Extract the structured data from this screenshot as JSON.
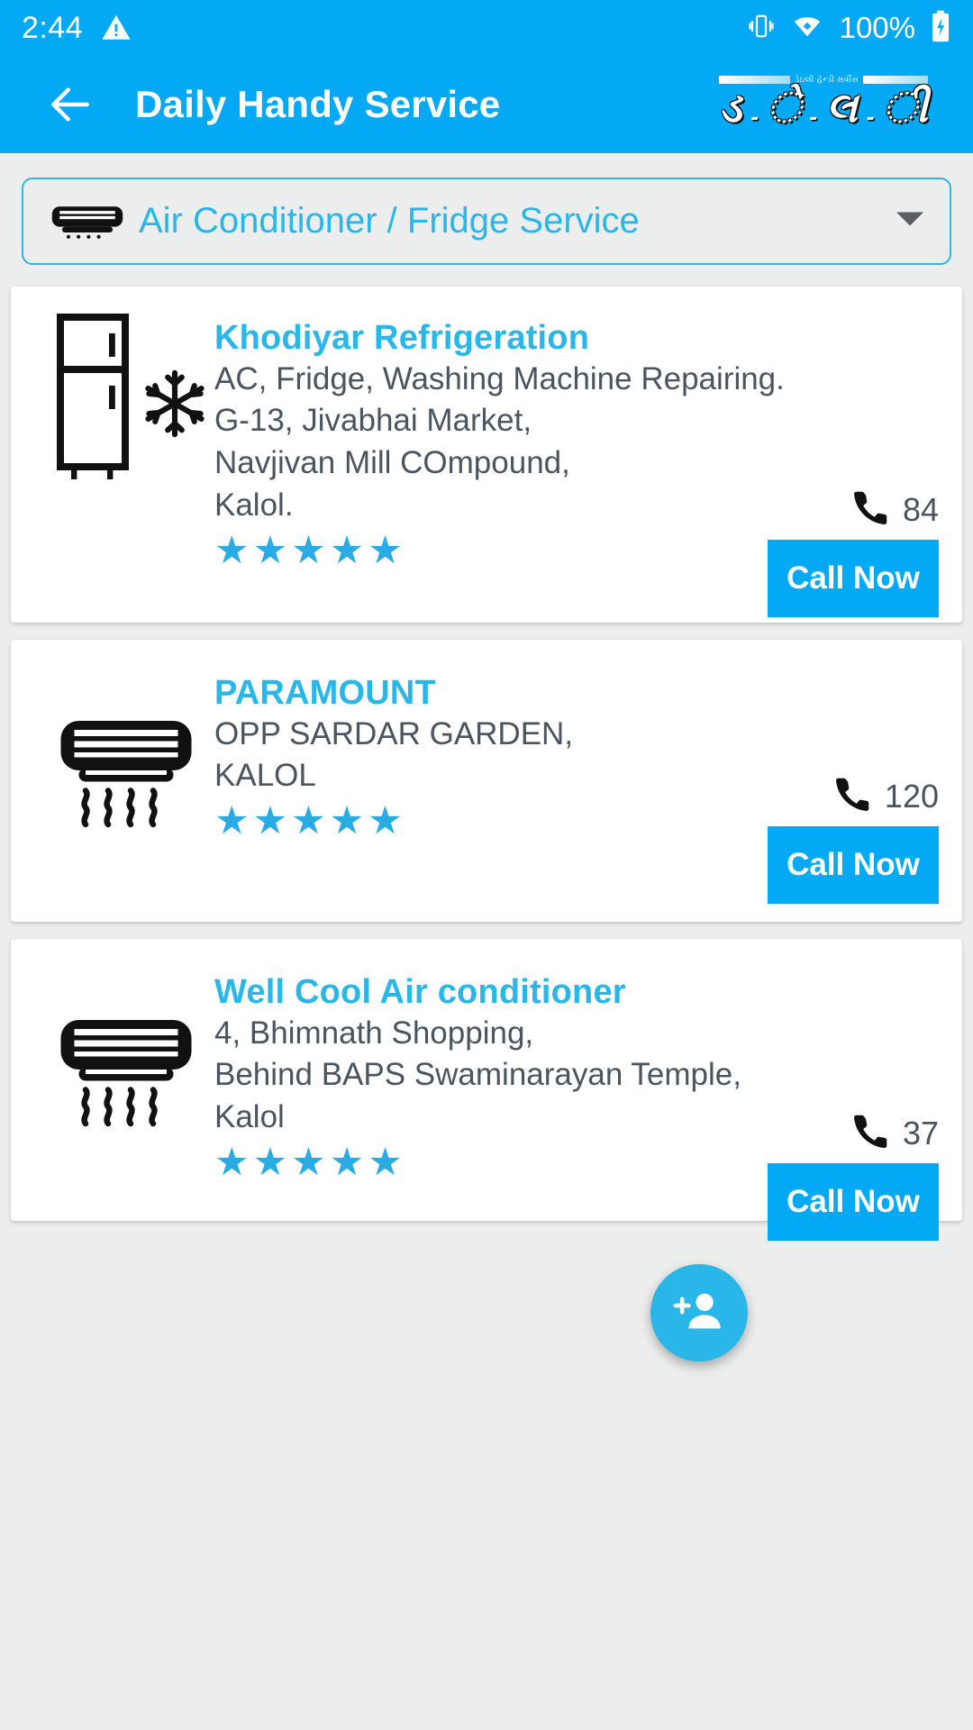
{
  "status_bar": {
    "time": "2:44",
    "warning_icon": "warning-triangle-icon",
    "vibrate_icon": "vibrate-icon",
    "wifi_icon": "wifi-icon",
    "battery_percent": "100%",
    "battery_icon": "battery-charging-icon"
  },
  "app_bar": {
    "back_icon": "back-arrow-icon",
    "title": "Daily Handy Service",
    "logo": {
      "tagline": "ડેઇલી હેન્ડી સર્વીસ",
      "glyphs": [
        "ડ",
        "ે",
        "લ",
        "ી"
      ],
      "separator": "-"
    }
  },
  "category_dropdown": {
    "icon": "air-conditioner-icon",
    "selected": "Air Conditioner / Fridge Service",
    "caret_icon": "chevron-down-icon"
  },
  "listings": [
    {
      "icon": "refrigerator-snowflake-icon",
      "name": "Khodiyar Refrigeration",
      "address_lines": [
        "AC, Fridge, Washing Machine Repairing.",
        "G-13, Jivabhai Market,",
        "Navjivan Mill COmpound,",
        "Kalol."
      ],
      "rating": 5,
      "call_count": "84",
      "phone_icon": "phone-icon",
      "call_label": "Call Now"
    },
    {
      "icon": "air-conditioner-airflow-icon",
      "name": "PARAMOUNT",
      "address_lines": [
        "OPP SARDAR GARDEN,",
        "KALOL"
      ],
      "rating": 5,
      "call_count": "120",
      "phone_icon": "phone-icon",
      "call_label": "Call Now"
    },
    {
      "icon": "air-conditioner-airflow-icon",
      "name": "Well Cool Air conditioner",
      "address_lines": [
        "4, Bhimnath Shopping,",
        "Behind BAPS Swaminarayan Temple,",
        "Kalol"
      ],
      "rating": 5,
      "call_count": "37",
      "phone_icon": "phone-icon",
      "call_label": "Call Now"
    }
  ],
  "fab": {
    "icon": "add-person-icon"
  },
  "colors": {
    "primary": "#03a9f4",
    "accent": "#29b6e8",
    "background": "#eceded",
    "card": "#ffffff",
    "text": "#4a5560",
    "star": "#2aabe4"
  }
}
